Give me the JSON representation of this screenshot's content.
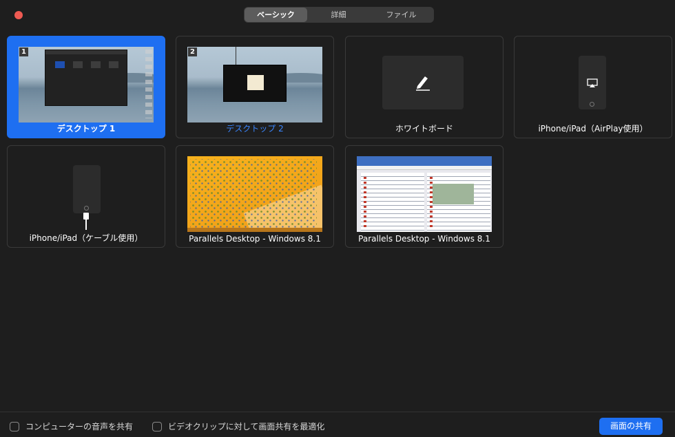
{
  "tabs": [
    {
      "label": "ベーシック",
      "active": true
    },
    {
      "label": "詳細",
      "active": false
    },
    {
      "label": "ファイル",
      "active": false
    }
  ],
  "tiles": [
    {
      "label": "デスクトップ 1",
      "badge": "1",
      "selected": true
    },
    {
      "label": "デスクトップ 2",
      "badge": "2",
      "selected": false
    },
    {
      "label": "ホワイトボード",
      "icon": "pencil-icon"
    },
    {
      "label": "iPhone/iPad（AirPlay使用）",
      "icon": "airplay-icon"
    },
    {
      "label": "iPhone/iPad（ケーブル使用）",
      "icon": "cable-icon"
    },
    {
      "label": "Parallels Desktop - Windows 8.1"
    },
    {
      "label": "Parallels Desktop - Windows 8.1"
    }
  ],
  "bottom": {
    "share_audio_label": "コンピューターの音声を共有",
    "optimize_video_label": "ビデオクリップに対して画面共有を最適化",
    "share_button_label": "画面の共有"
  },
  "colors": {
    "accent": "#1e6ff1",
    "background": "#1e1e1e",
    "close_button": "#ee5a52"
  }
}
